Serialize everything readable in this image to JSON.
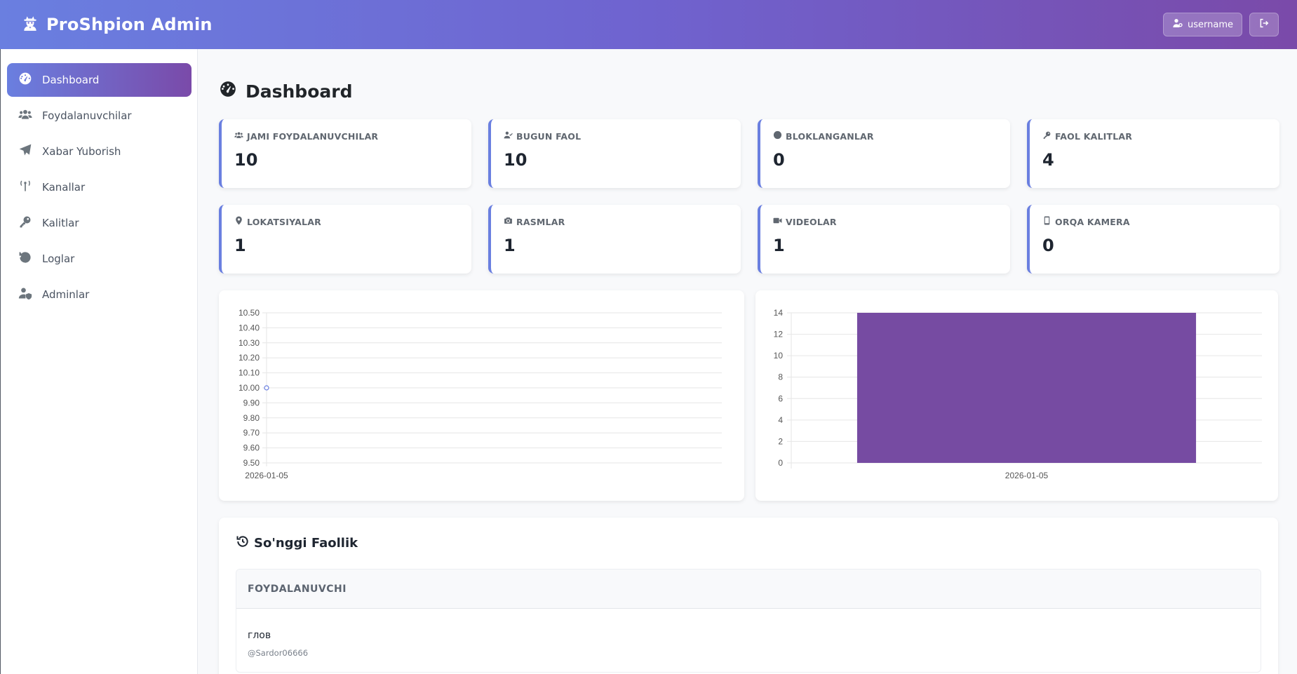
{
  "app": {
    "title": "ProShpion Admin",
    "username": "username"
  },
  "sidebar": {
    "items": [
      {
        "label": "Dashboard",
        "icon": "gauge-icon",
        "active": true
      },
      {
        "label": "Foydalanuvchilar",
        "icon": "users-icon"
      },
      {
        "label": "Xabar Yuborish",
        "icon": "paper-plane-icon"
      },
      {
        "label": "Kanallar",
        "icon": "broadcast-tower-icon"
      },
      {
        "label": "Kalitlar",
        "icon": "key-icon"
      },
      {
        "label": "Loglar",
        "icon": "history-icon"
      },
      {
        "label": "Adminlar",
        "icon": "user-shield-icon"
      }
    ]
  },
  "page": {
    "title": "Dashboard"
  },
  "stats": [
    {
      "label": "JAMI FOYDALANUVCHILAR",
      "value": "10",
      "icon": "users-icon"
    },
    {
      "label": "BUGUN FAOL",
      "value": "10",
      "icon": "user-check-icon"
    },
    {
      "label": "BLOKLANGANLAR",
      "value": "0",
      "icon": "ban-icon"
    },
    {
      "label": "FAOL KALITLAR",
      "value": "4",
      "icon": "key-icon"
    },
    {
      "label": "LOKATSIYALAR",
      "value": "1",
      "icon": "map-pin-icon"
    },
    {
      "label": "RASMLAR",
      "value": "1",
      "icon": "camera-icon"
    },
    {
      "label": "VIDEOLAR",
      "value": "1",
      "icon": "video-icon"
    },
    {
      "label": "ORQA KAMERA",
      "value": "0",
      "icon": "mobile-icon"
    }
  ],
  "chart_data": [
    {
      "type": "line",
      "x": [
        "2026-01-05"
      ],
      "series": [
        {
          "values": [
            10
          ]
        }
      ],
      "ylim": [
        9.5,
        10.5
      ],
      "yticks": [
        "10.50",
        "10.40",
        "10.30",
        "10.20",
        "10.10",
        "10.00",
        "9.90",
        "9.80",
        "9.70",
        "9.60",
        "9.50"
      ],
      "grid": true,
      "color": "#6a7fe0"
    },
    {
      "type": "bar",
      "categories": [
        "2026-01-05"
      ],
      "values": [
        14
      ],
      "ylim": [
        0,
        14
      ],
      "yticks": [
        "14",
        "12",
        "10",
        "8",
        "6",
        "4",
        "2",
        "0"
      ],
      "grid": true,
      "color": "#764ba2"
    }
  ],
  "activity": {
    "title": "So'nggi Faollik",
    "column": "FOYDALANUVCHI",
    "rows": [
      {
        "name": "глов",
        "username": "@Sardor06666"
      }
    ]
  },
  "colors": {
    "accent": "#6a7fe0",
    "accent2": "#764ba2"
  }
}
